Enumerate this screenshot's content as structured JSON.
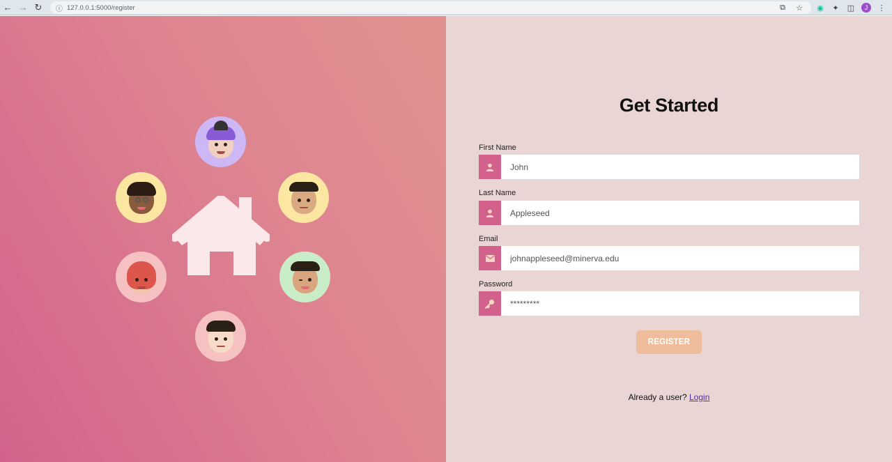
{
  "browser": {
    "url": "127.0.0.1:5000/register",
    "profile_initial": "J"
  },
  "hero": {
    "icon": "house-icon",
    "memojis": [
      {
        "name": "purple-hair-memoji",
        "bg": "#cdb8f5"
      },
      {
        "name": "braids-memoji",
        "bg": "#fbe7a1"
      },
      {
        "name": "man-memoji",
        "bg": "#fbe7a1"
      },
      {
        "name": "redhead-memoji",
        "bg": "#f5c1c1"
      },
      {
        "name": "winking-memoji",
        "bg": "#c9ecc9"
      },
      {
        "name": "boy-memoji",
        "bg": "#f5c1c1"
      }
    ]
  },
  "form": {
    "title": "Get Started",
    "fields": {
      "first_name": {
        "label": "First Name",
        "value": "John",
        "icon": "user-icon"
      },
      "last_name": {
        "label": "Last Name",
        "value": "Appleseed",
        "icon": "user-icon"
      },
      "email": {
        "label": "Email",
        "value": "johnappleseed@minerva.edu",
        "icon": "envelope-icon"
      },
      "password": {
        "label": "Password",
        "value": "*********",
        "icon": "key-icon"
      }
    },
    "register_label": "REGISTER",
    "already_text": "Already a user?",
    "login_label": "Login"
  },
  "colors": {
    "accent": "#d2628c",
    "button": "#f0bd9c",
    "panel": "#ead5d5"
  }
}
